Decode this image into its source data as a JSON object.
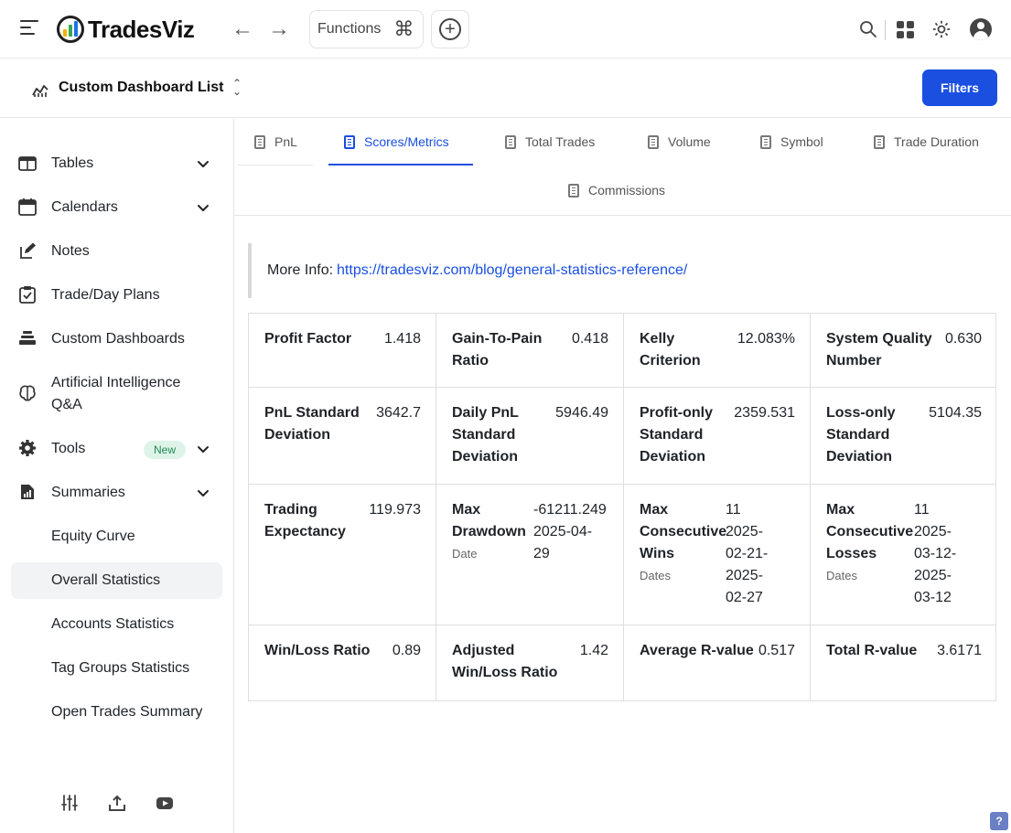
{
  "app": {
    "name": "TradesViz"
  },
  "topbar": {
    "functions_label": "Functions",
    "functions_shortcut_icon": "command-icon",
    "back_icon": "arrow-left-icon",
    "forward_icon": "arrow-right-icon",
    "add_icon": "plus-circle-icon",
    "search_icon": "search-icon",
    "apps_icon": "grid-icon",
    "theme_icon": "sun-icon",
    "account_icon": "user-avatar-icon"
  },
  "subheader": {
    "title": "Custom Dashboard List",
    "filters_label": "Filters"
  },
  "sidebar": {
    "items": [
      {
        "label": "Tables",
        "icon": "table-icon",
        "expandable": true
      },
      {
        "label": "Calendars",
        "icon": "calendar-icon",
        "expandable": true
      },
      {
        "label": "Notes",
        "icon": "pencil-note-icon",
        "expandable": false
      },
      {
        "label": "Trade/Day Plans",
        "icon": "clipboard-check-icon",
        "expandable": false
      },
      {
        "label": "Custom Dashboards",
        "icon": "stack-icon",
        "expandable": false
      },
      {
        "label": "Artificial Intelligence Q&A",
        "label_line1": "Artificial Intelligence",
        "label_line2": "Q&A",
        "icon": "brain-icon",
        "expandable": false
      },
      {
        "label": "Tools",
        "icon": "gear-icon",
        "expandable": true,
        "badge": "New"
      },
      {
        "label": "Summaries",
        "icon": "report-icon",
        "expandable": true
      }
    ],
    "summaries_children": [
      "Equity Curve",
      "Overall Statistics",
      "Accounts Statistics",
      "Tag Groups Statistics",
      "Open Trades Summary"
    ],
    "active_child": "Overall Statistics",
    "footer_icons": [
      "sliders-icon",
      "upload-icon",
      "youtube-icon"
    ]
  },
  "tabs": {
    "items": [
      "PnL",
      "Scores/Metrics",
      "Total Trades",
      "Volume",
      "Symbol",
      "Trade Duration",
      "Commissions"
    ],
    "active": "Scores/Metrics"
  },
  "info": {
    "prefix": "More Info:",
    "link": "https://tradesviz.com/blog/general-statistics-reference/"
  },
  "metrics": {
    "row1": [
      {
        "label": "Profit Factor",
        "value": "1.418"
      },
      {
        "label_l1": "Gain-To-Pain",
        "label_l2": "Ratio",
        "label": "Gain-To-Pain Ratio",
        "value": "0.418"
      },
      {
        "label_l1": "Kelly",
        "label_l2": "Criterion",
        "label": "Kelly Criterion",
        "value": "12.083%"
      },
      {
        "label_l1": "System Quality",
        "label_l2": "Number",
        "label": "System Quality Number",
        "value": "0.630"
      }
    ],
    "row2": [
      {
        "label_l1": "PnL Standard",
        "label_l2": "Deviation",
        "label": "PnL Standard Deviation",
        "value": "3642.7"
      },
      {
        "label_l1": "Daily PnL",
        "label_l2": "Standard",
        "label_l3": "Deviation",
        "label": "Daily PnL Standard Deviation",
        "value": "5946.49"
      },
      {
        "label_l1": "Profit-only",
        "label_l2": "Standard",
        "label_l3": "Deviation",
        "label": "Profit-only Standard Deviation",
        "value": "2359.531"
      },
      {
        "label_l1": "Loss-only",
        "label_l2": "Standard",
        "label_l3": "Deviation",
        "label": "Loss-only Standard Deviation",
        "value": "5104.35"
      }
    ],
    "row3": [
      {
        "label_l1": "Trading",
        "label_l2": "Expectancy",
        "label": "Trading Expectancy",
        "value": "119.973"
      },
      {
        "label_l1": "Max",
        "label_l2": "Drawdown",
        "label": "Max Drawdown",
        "value": "-61211.249",
        "sub_label": "Date",
        "date_l1": "2025-04-",
        "date_l2": "29"
      },
      {
        "label_l1": "Max",
        "label_l2": "Consecutive",
        "label_l3": "Wins",
        "label": "Max Consecutive Wins",
        "value": "11",
        "sub_label": "Dates",
        "date_lines": [
          "2025-",
          "02-21-",
          "2025-",
          "02-27"
        ]
      },
      {
        "label_l1": "Max",
        "label_l2": "Consecutive",
        "label_l3": "Losses",
        "label": "Max Consecutive Losses",
        "value": "11",
        "sub_label": "Dates",
        "date_lines": [
          "2025-",
          "03-12-",
          "2025-",
          "03-12"
        ]
      }
    ],
    "row4": [
      {
        "label": "Win/Loss Ratio",
        "value": "0.89"
      },
      {
        "label_l1": "Adjusted",
        "label_l2": "Win/Loss Ratio",
        "label": "Adjusted Win/Loss Ratio",
        "value": "1.42"
      },
      {
        "label": "Average R-value",
        "value": "0.517"
      },
      {
        "label": "Total R-value",
        "value": "3.6171"
      }
    ]
  },
  "help_label": "?"
}
